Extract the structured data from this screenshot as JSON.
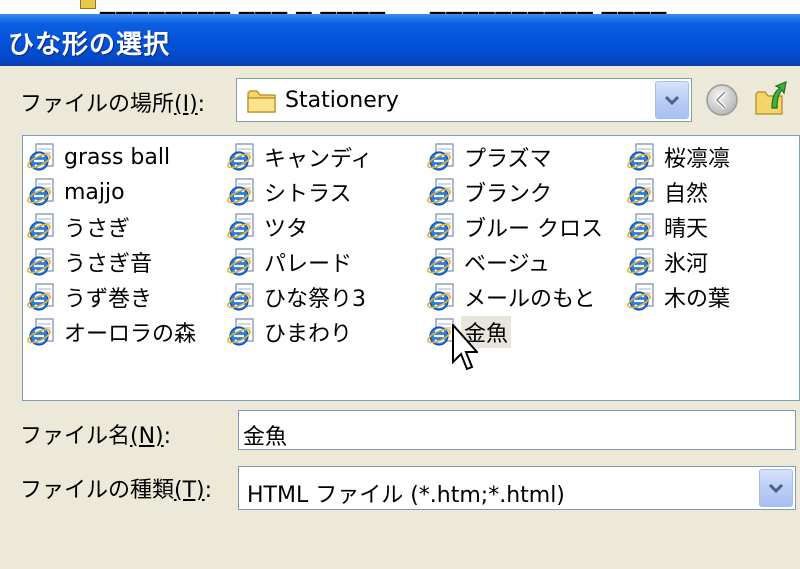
{
  "background_window": {
    "fragment_left": "▁▁▁▁▁▁▁▁ ▁▁▁ ▁ ▁▁▁▁",
    "fragment_right": "▁▁▁▁▁▁▁▁▁▁ ▁▁▁▁"
  },
  "dialog": {
    "title": "ひな形の選択"
  },
  "look_in": {
    "label": "ファイルの場所",
    "accel": "(I)",
    "suffix": ":",
    "value": "Stationery"
  },
  "files": [
    {
      "name": "grass ball"
    },
    {
      "name": "majjo"
    },
    {
      "name": "うさぎ"
    },
    {
      "name": "うさぎ音"
    },
    {
      "name": "うず巻き"
    },
    {
      "name": "オーロラの森"
    },
    {
      "name": "キャンディ"
    },
    {
      "name": "シトラス"
    },
    {
      "name": "ツタ"
    },
    {
      "name": "パレード"
    },
    {
      "name": "ひな祭り3"
    },
    {
      "name": "ひまわり"
    },
    {
      "name": "プラズマ"
    },
    {
      "name": "ブランク"
    },
    {
      "name": "ブルー クロス"
    },
    {
      "name": "ベージュ"
    },
    {
      "name": "メールのもと"
    },
    {
      "name": "金魚"
    },
    {
      "name": "桜凛凛"
    },
    {
      "name": "自然"
    },
    {
      "name": "晴天"
    },
    {
      "name": "氷河"
    },
    {
      "name": "木の葉"
    }
  ],
  "filename": {
    "label": "ファイル名",
    "accel": "(N)",
    "suffix": ":",
    "value": "金魚"
  },
  "filetype": {
    "label": "ファイルの種類",
    "accel": "(T)",
    "suffix": ":",
    "value": "HTML ファイル (*.htm;*.html)"
  },
  "icons": {
    "file": "ie-document-icon",
    "folder": "folder-icon",
    "back": "back-arrow-icon",
    "up": "up-folder-icon",
    "dropdown": "chevron-down-icon"
  }
}
